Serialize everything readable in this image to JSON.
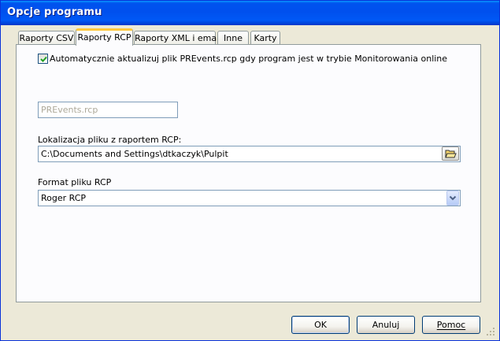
{
  "window": {
    "title": "Opcje programu"
  },
  "tabs": [
    {
      "label": "Raporty CSV",
      "active": false
    },
    {
      "label": "Raporty RCP",
      "active": true
    },
    {
      "label": "Raporty XML i email",
      "active": false
    },
    {
      "label": "Inne",
      "active": false
    },
    {
      "label": "Karty",
      "active": false
    }
  ],
  "rcp": {
    "auto_update_checked": true,
    "auto_update_label": "Automatycznie aktualizuj plik PREvents.rcp gdy program jest w trybie Monitorowania online",
    "filename_value": "PREvents.rcp",
    "location_label": "Lokalizacja pliku z raportem RCP:",
    "location_value": "C:\\Documents and Settings\\dtkaczyk\\Pulpit",
    "format_label": "Format pliku RCP",
    "format_value": "Roger RCP"
  },
  "buttons": {
    "ok": "OK",
    "cancel": "Anuluj",
    "help": "Pomoc"
  },
  "colors": {
    "titlebar": "#0053ee",
    "tab_highlight": "#ffc83c",
    "dialog_bg": "#ece9d8"
  }
}
